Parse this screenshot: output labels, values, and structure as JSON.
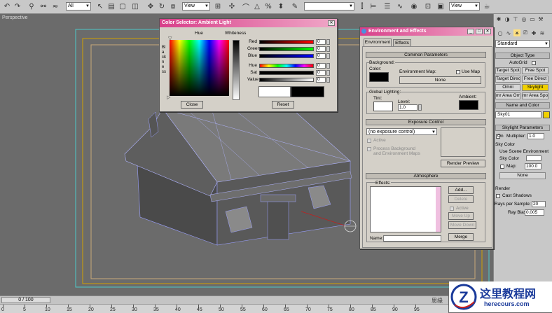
{
  "toolbar": {
    "filter_select": "All",
    "ref_coord_select": "View",
    "named_sel_select": "",
    "view_select": "View"
  },
  "viewport": {
    "label": "Perspective"
  },
  "timeline": {
    "slider_text": "0 / 100",
    "ticks": [
      "0",
      "5",
      "10",
      "15",
      "20",
      "25",
      "30",
      "35",
      "40",
      "45",
      "50",
      "55",
      "60",
      "65",
      "70",
      "75",
      "80",
      "85",
      "90",
      "95"
    ]
  },
  "command_panel": {
    "category_select": "Standard",
    "object_type_header": "Object Type",
    "autogrid_label": "AutoGrid",
    "buttons": [
      "Target Spot",
      "Free Spot",
      "Target Direct",
      "Free Direct",
      "Omni",
      "Skylight",
      "mr Area Omni",
      "mr Area Spot"
    ],
    "name_color_header": "Name and Color",
    "object_name": "Sky01",
    "name_color_swatch": "#f0d000",
    "skylight_params_header": "Skylight Parameters",
    "on_label": "On",
    "multiplier_label": "Multiplier:",
    "multiplier_value": "1.0",
    "sky_color_label": "Sky Color",
    "use_scene_env_label": "Use Scene Environment",
    "sky_color_radio_label": "Sky Color",
    "map_label": "Map:",
    "map_value": "100.0",
    "none_button": "None",
    "render_label": "Render",
    "cast_shadows_label": "Cast Shadows",
    "rays_label": "Rays per Sample:",
    "rays_value": "20",
    "ray_bias_label": "Ray Bias:",
    "ray_bias_value": "0.005"
  },
  "color_selector": {
    "title": "Color Selector: Ambient Light",
    "hue_label": "Hue",
    "whiteness_label": "Whiteness",
    "blackness_label": "Blackness",
    "channels": [
      {
        "label": "Red",
        "value": "0"
      },
      {
        "label": "Green",
        "value": "0"
      },
      {
        "label": "Blue",
        "value": "0"
      },
      {
        "label": "Hue",
        "value": "0"
      },
      {
        "label": "Sat",
        "value": "0"
      },
      {
        "label": "Value",
        "value": "0"
      }
    ],
    "close_button": "Close",
    "reset_button": "Reset"
  },
  "env_dialog": {
    "title": "Environment and Effects",
    "tabs": [
      "Environment",
      "Effects"
    ],
    "common_params_header": "Common Parameters",
    "background_label": "Background:",
    "color_label": "Color:",
    "env_map_label": "Environment Map:",
    "use_map_label": "Use Map",
    "env_map_button": "None",
    "global_lighting_label": "Global Lighting:",
    "tint_label": "Tint:",
    "level_label": "Level:",
    "level_value": "1.0",
    "ambient_label": "Ambient:",
    "exposure_header": "Exposure Control",
    "exposure_select": "(no exposure control)",
    "active_label": "Active",
    "process_bg_label": "Process Background",
    "process_bg_label2": "and Environment Maps",
    "render_preview_button": "Render Preview",
    "atmosphere_header": "Atmosphere",
    "effects_label": "Effects:",
    "add_button": "Add...",
    "delete_button": "Delete",
    "active2_label": "Active",
    "move_up_button": "Move Up",
    "move_down_button": "Move Down",
    "name_label": "Name:",
    "merge_button": "Merge"
  },
  "watermark": {
    "title": "这里教程网",
    "url": "herecours.com"
  },
  "status": {
    "text": "思缘"
  }
}
